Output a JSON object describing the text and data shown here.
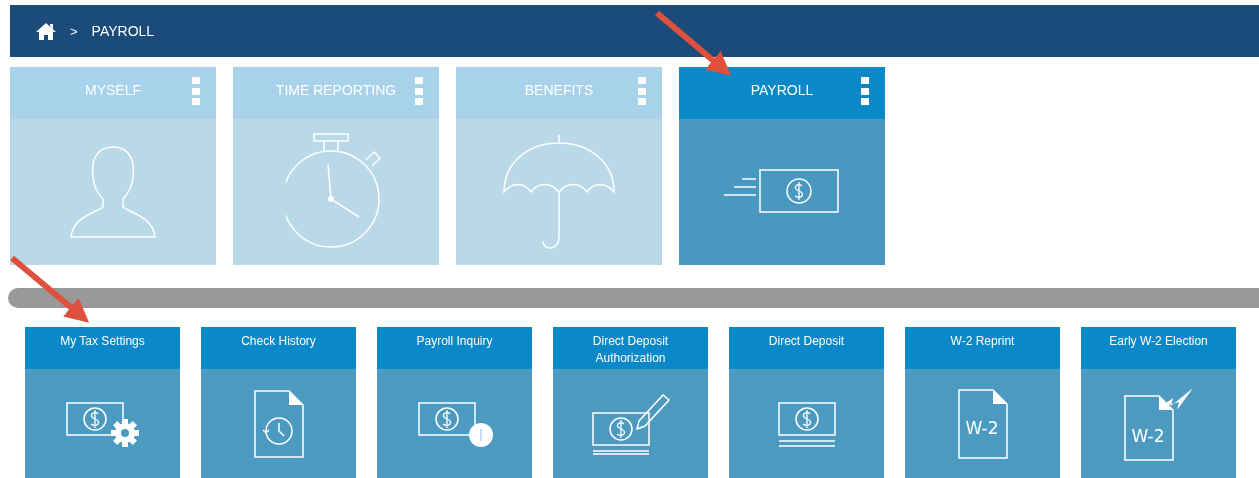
{
  "breadcrumb": {
    "separator": ">",
    "current": "PAYROLL"
  },
  "categories": [
    {
      "label": "MYSELF",
      "kind": "person",
      "selected": false
    },
    {
      "label": "TIME REPORTING",
      "kind": "stopwatch",
      "selected": false
    },
    {
      "label": "BENEFITS",
      "kind": "umbrella",
      "selected": false
    },
    {
      "label": "PAYROLL",
      "kind": "money",
      "selected": true
    }
  ],
  "actions": [
    {
      "label": "My Tax Settings",
      "kind": "settings"
    },
    {
      "label": "Check History",
      "kind": "history"
    },
    {
      "label": "Payroll Inquiry",
      "kind": "inquiry"
    },
    {
      "label": "Direct Deposit Authorization",
      "kind": "authorization"
    },
    {
      "label": "Direct Deposit",
      "kind": "deposit"
    },
    {
      "label": "W-2 Reprint",
      "kind": "reprint",
      "icon_text": "W-2"
    },
    {
      "label": "Early W-2 Election",
      "kind": "election",
      "icon_text": "W-2"
    }
  ]
}
